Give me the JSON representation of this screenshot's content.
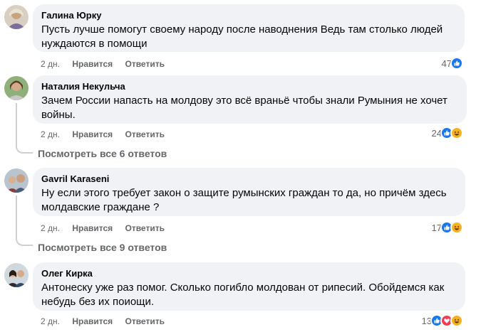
{
  "comments": [
    {
      "author": "Галина Юрку",
      "text_line1": "Пусть лучше помогут своему народу после наводнения Ведь там столько людей",
      "text_line2": "нуждаются в помощи",
      "time": "2 дн.",
      "like_label": "Нравится",
      "reply_label": "Ответить",
      "reaction_count": "47",
      "reactions": [
        "like-icon"
      ]
    },
    {
      "author": "Наталия Некульча",
      "text_line1": "Зачем России напасть на молдову это всё враньё чтобы знали Румыния не хочет",
      "text_line2": "войны.",
      "time": "2 дн.",
      "like_label": "Нравится",
      "reply_label": "Ответить",
      "reaction_count": "24",
      "reactions": [
        "like-icon",
        "haha-icon"
      ],
      "view_replies": "Посмотреть все 6 ответов"
    },
    {
      "author": "Gavril Karaseni",
      "text_line1": "Ну если этого требует закон о защите румынских граждан то да, но причём здесь",
      "text_line2": "молдавские граждане ?",
      "time": "2 дн.",
      "like_label": "Нравится",
      "reply_label": "Ответить",
      "reaction_count": "17",
      "reactions": [
        "like-icon",
        "haha-icon"
      ],
      "view_replies": "Посмотреть все 9 ответов"
    },
    {
      "author": "Олег Кирка",
      "text_line1": "Антонеску уже раз помог. Сколько погибло молдован от рипесий. Обойдемся как",
      "text_line2": "небудь без их поиощи.",
      "time": "2 дн.",
      "like_label": "Нравится",
      "reply_label": "Ответить",
      "reaction_count": "13",
      "reactions": [
        "like-icon",
        "love-icon",
        "haha-icon"
      ]
    }
  ],
  "colors": {
    "bubble_bg": "#f0f2f5",
    "meta_text": "#65676b",
    "like_blue": "#1877f2",
    "love_red": "#f33e58",
    "haha_yellow": "#f7b125"
  }
}
